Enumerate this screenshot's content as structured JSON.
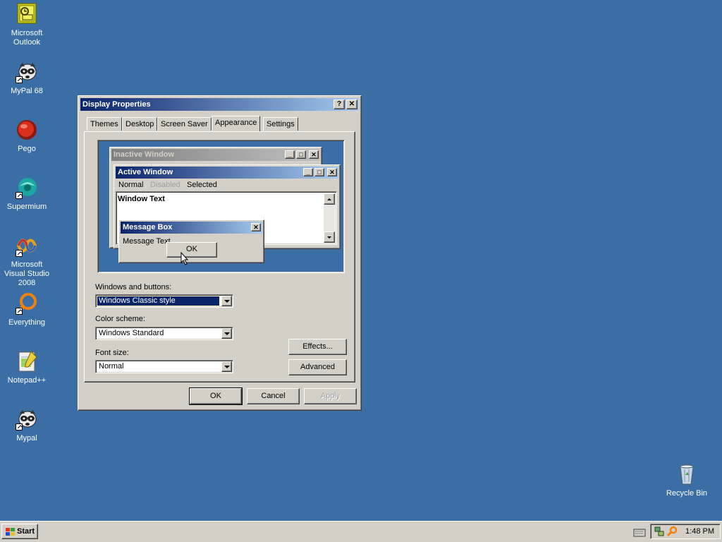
{
  "desktop": {
    "icons": [
      {
        "label": "Microsoft Outlook",
        "icon": "outlook-icon"
      },
      {
        "label": "MyPal 68",
        "icon": "raccoon-icon"
      },
      {
        "label": "Pego",
        "icon": "pego-icon"
      },
      {
        "label": "Supermium",
        "icon": "supermium-icon"
      },
      {
        "label": "Microsoft Visual Studio 2008",
        "icon": "visual-studio-icon"
      },
      {
        "label": "Everything",
        "icon": "everything-icon"
      },
      {
        "label": "Notepad++",
        "icon": "notepadpp-icon"
      },
      {
        "label": "Mypal",
        "icon": "raccoon-icon"
      },
      {
        "label": "Recycle Bin",
        "icon": "recycle-bin-icon"
      }
    ]
  },
  "dialog": {
    "title": "Display Properties",
    "help_glyph": "?",
    "close_glyph": "✕",
    "tabs": [
      {
        "label": "Themes"
      },
      {
        "label": "Desktop"
      },
      {
        "label": "Screen Saver"
      },
      {
        "label": "Appearance",
        "active": true
      },
      {
        "label": "Settings"
      }
    ],
    "preview": {
      "inactive_title": "Inactive Window",
      "active_title": "Active Window",
      "menu_normal": "Normal",
      "menu_disabled": "Disabled",
      "menu_selected": "Selected",
      "window_text": "Window Text",
      "msgbox_title": "Message Box",
      "msgbox_text": "Message Text",
      "msgbox_ok": "OK"
    },
    "windows_buttons_label": "Windows and buttons:",
    "windows_buttons_value": "Windows Classic style",
    "color_scheme_label": "Color scheme:",
    "color_scheme_value": "Windows Standard",
    "font_size_label": "Font size:",
    "font_size_value": "Normal",
    "effects_button": "Effects...",
    "advanced_button": "Advanced",
    "ok_button": "OK",
    "cancel_button": "Cancel",
    "apply_button": "Apply"
  },
  "taskbar": {
    "start_label": "Start",
    "clock": "1:48 PM"
  },
  "colors": {
    "desktop": "#3a6ea5",
    "active_title_start": "#0a246a",
    "active_title_end": "#a6caf0",
    "inactive_title_start": "#808080",
    "inactive_title_end": "#c0c0c0"
  }
}
